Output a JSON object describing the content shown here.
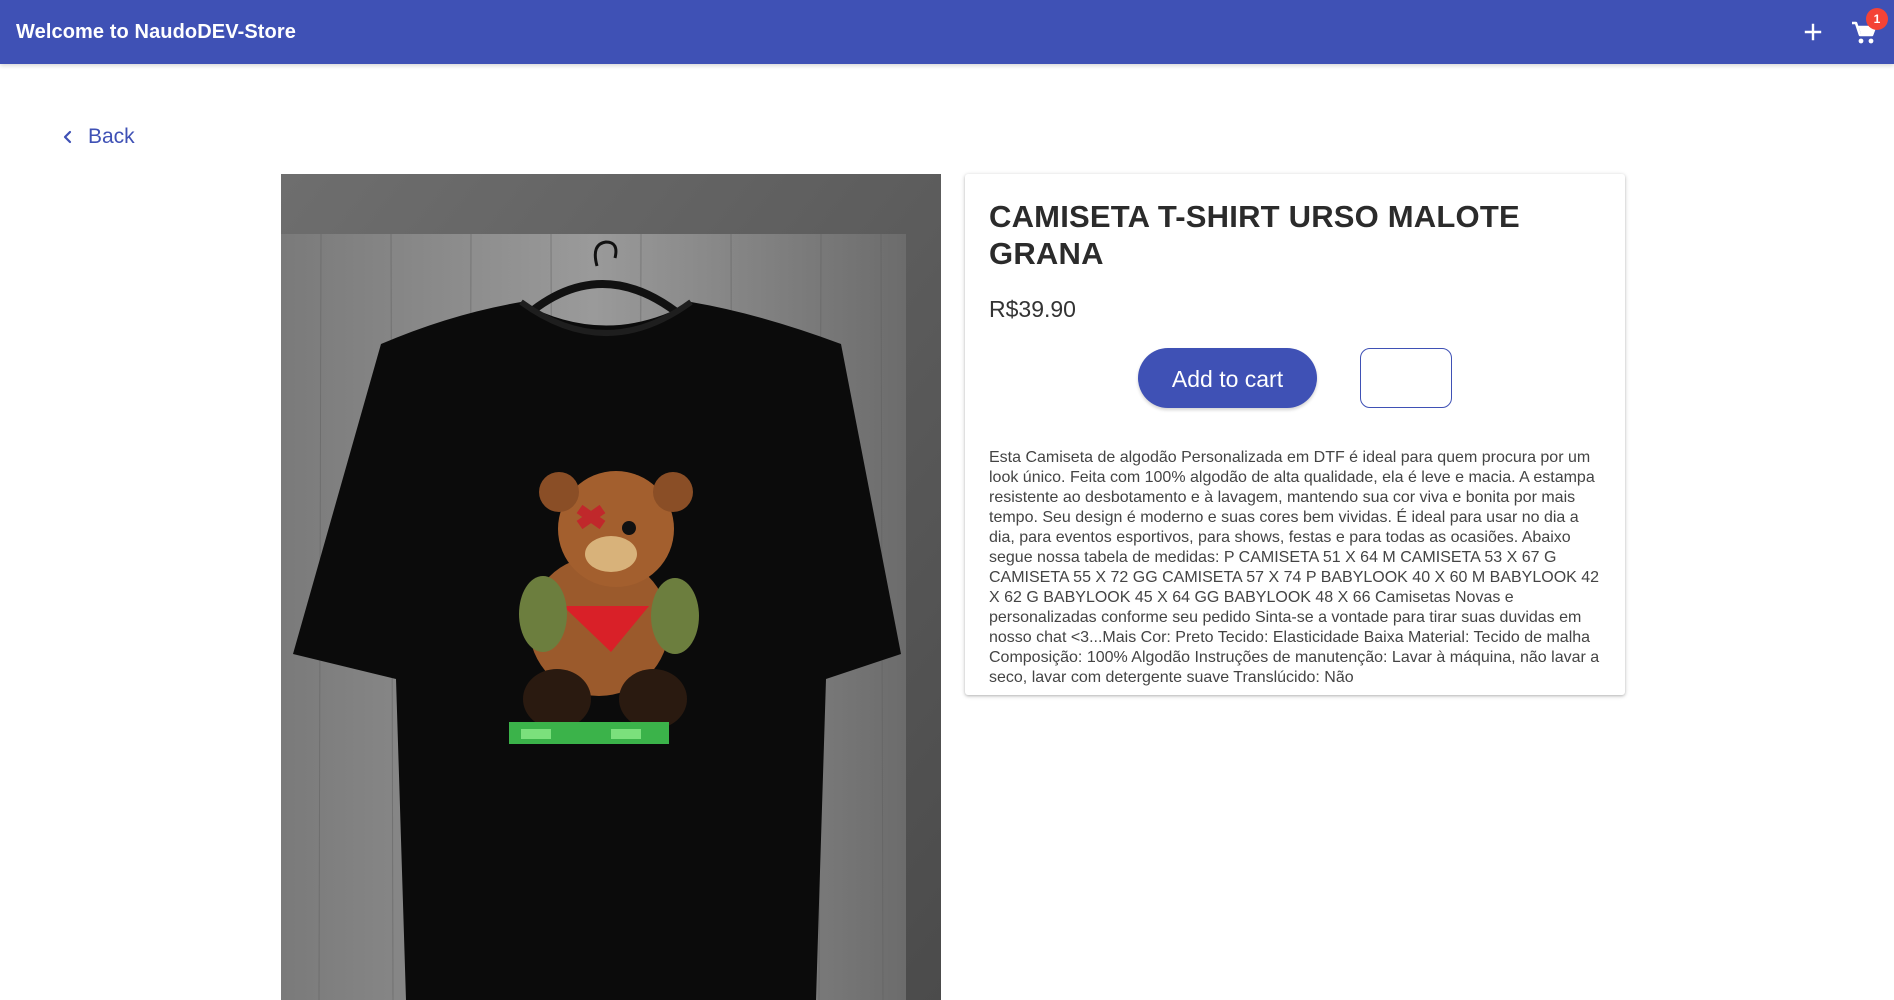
{
  "header": {
    "title": "Welcome to NaudoDEV-Store",
    "add_icon": "plus-icon",
    "cart_icon": "shopping-cart-icon",
    "cart_count": "1",
    "bar_color": "#3f51b5",
    "badge_color": "#f44336"
  },
  "nav": {
    "back_label": "Back",
    "back_icon": "chevron-left-icon"
  },
  "product": {
    "title": "CAMISETA T-SHIRT URSO MALOTE GRANA",
    "price": "R$39.90",
    "add_to_cart_label": "Add to cart",
    "quantity_value": "",
    "description": "Esta Camiseta de algodão Personalizada em DTF é ideal para quem procura por um look único. Feita com 100% algodão de alta qualidade, ela é leve e macia. A estampa resistente ao desbotamento e à lavagem, mantendo sua cor viva e bonita por mais tempo. Seu design é moderno e suas cores bem vividas. É ideal para usar no dia a dia, para eventos esportivos, para shows, festas e para todas as ocasiões. Abaixo segue nossa tabela de medidas: P CAMISETA 51 X 64 M CAMISETA 53 X 67 G CAMISETA 55 X 72 GG CAMISETA 57 X 74 P BABYLOOK 40 X 60 M BABYLOOK 42 X 62 G BABYLOOK 45 X 64 GG BABYLOOK 48 X 66 Camisetas Novas e personalizadas conforme seu pedido Sinta-se a vontade para tirar suas duvidas em nosso chat <3...Mais Cor: Preto Tecido: Elasticidade Baixa Material: Tecido de malha Composição: 100% Algodão Instruções de manutenção: Lavar à máquina, não lavar a seco, lavar com detergente suave Translúcido: Não",
    "image": "black-tshirt-teddy-bear-print"
  }
}
